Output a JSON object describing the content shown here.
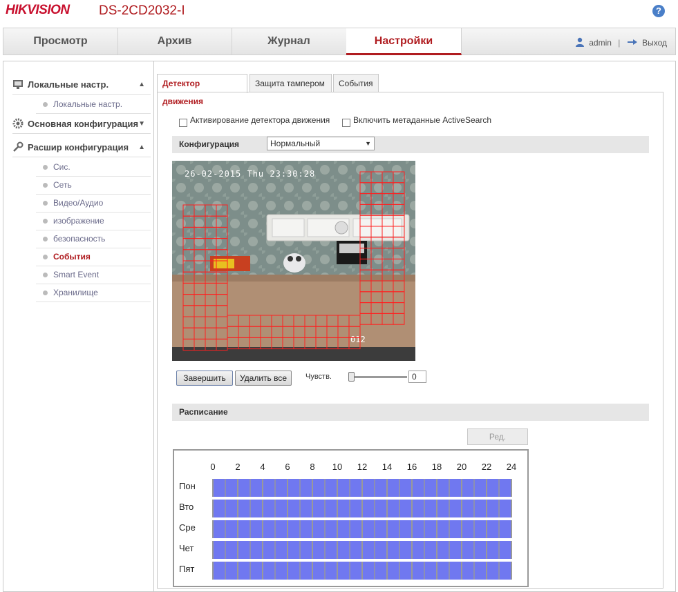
{
  "header": {
    "logo": "HIKVISION",
    "model": "DS-2CD2032-I",
    "help_icon": "?"
  },
  "nav": {
    "tabs": [
      "Просмотр",
      "Архив",
      "Журнал",
      "Настройки"
    ],
    "active": "Настройки",
    "user": "admin",
    "separator": "|",
    "logout": "Выход"
  },
  "sidebar": {
    "groups": [
      {
        "label": "Локальные настр.",
        "items": [
          "Локальные настр."
        ]
      },
      {
        "label": "Основная конфигурация",
        "items": []
      },
      {
        "label": "Расшир конфигурация",
        "items": [
          "Сис.",
          "Сеть",
          "Видео/Аудио",
          "изображение",
          "безопасность",
          "События",
          "Smart Event",
          "Хранилище"
        ]
      }
    ],
    "active_item": "События"
  },
  "tabs": [
    "Детектор движения",
    "Защита тампером",
    "События"
  ],
  "motion": {
    "enable_label": "Активирование детектора движения",
    "metadata_label": "Включить метаданные ActiveSearch",
    "config_label": "Конфигурация",
    "config_value": "Нормальный",
    "osd_time": "26-02-2015 Thu 23:30:28",
    "osd_cam": "012",
    "finish_button": "Завершить",
    "delete_button": "Удалить все",
    "sensitivity_label": "Чувств.",
    "sensitivity_value": "0"
  },
  "schedule": {
    "title": "Расписание",
    "edit_button": "Ред.",
    "hours": [
      "0",
      "2",
      "4",
      "6",
      "8",
      "10",
      "12",
      "14",
      "16",
      "18",
      "20",
      "22",
      "24"
    ],
    "days": [
      "Пон",
      "Вто",
      "Сре",
      "Чет",
      "Пят"
    ]
  },
  "colors": {
    "brand": "#c8102e",
    "accent": "#b01c20",
    "schedule_fill": "#7078f0",
    "grid": "#ff2020"
  }
}
